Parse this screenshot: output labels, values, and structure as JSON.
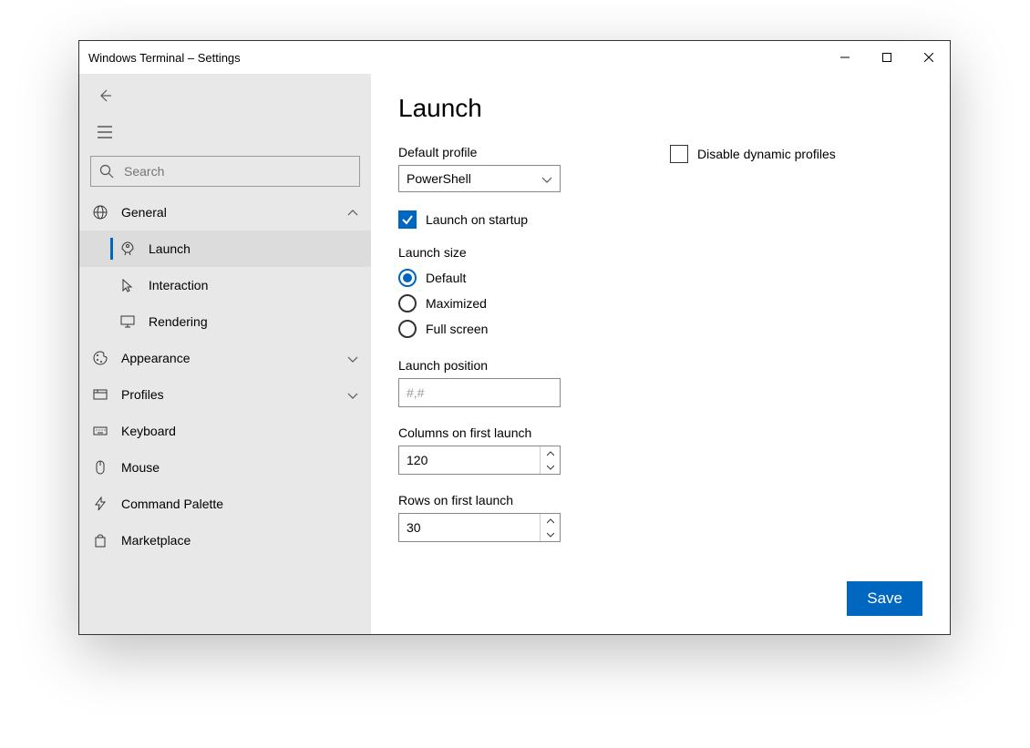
{
  "window": {
    "title": "Windows Terminal – Settings"
  },
  "sidebar": {
    "search_placeholder": "Search",
    "groups": {
      "general": "General",
      "launch": "Launch",
      "interaction": "Interaction",
      "rendering": "Rendering",
      "appearance": "Appearance",
      "profiles": "Profiles",
      "keyboard": "Keyboard",
      "mouse": "Mouse",
      "command_palette": "Command Palette",
      "marketplace": "Marketplace"
    }
  },
  "page": {
    "title": "Launch",
    "default_profile_label": "Default profile",
    "default_profile_value": "PowerShell",
    "disable_dynamic_label": "Disable dynamic profiles",
    "disable_dynamic_checked": false,
    "launch_on_startup_label": "Launch on startup",
    "launch_on_startup_checked": true,
    "launch_size_label": "Launch size",
    "launch_size_options": {
      "default": "Default",
      "maximized": "Maximized",
      "fullscreen": "Full screen"
    },
    "launch_size_selected": "default",
    "launch_position_label": "Launch position",
    "launch_position_placeholder": "#,#",
    "launch_position_value": "",
    "columns_label": "Columns on first launch",
    "columns_value": "120",
    "rows_label": "Rows on first launch",
    "rows_value": "30",
    "save_label": "Save"
  }
}
